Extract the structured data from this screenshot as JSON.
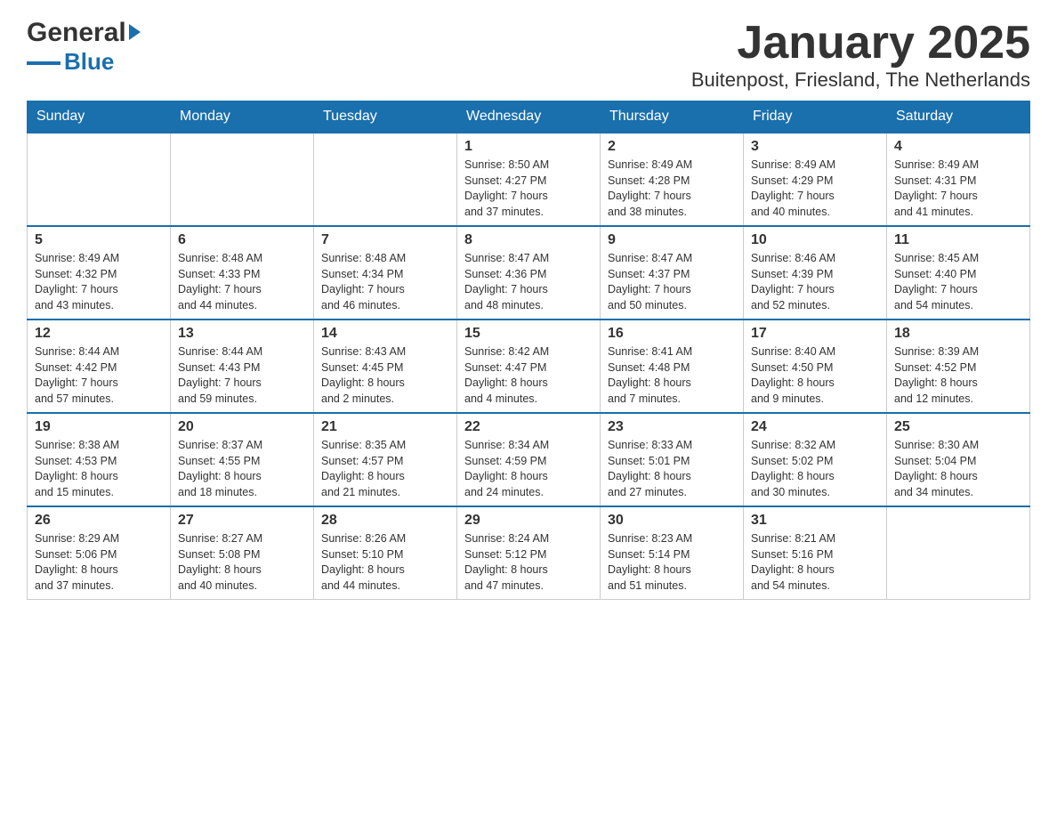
{
  "header": {
    "logo_general": "General",
    "logo_blue": "Blue",
    "title": "January 2025",
    "subtitle": "Buitenpost, Friesland, The Netherlands"
  },
  "calendar": {
    "days_of_week": [
      "Sunday",
      "Monday",
      "Tuesday",
      "Wednesday",
      "Thursday",
      "Friday",
      "Saturday"
    ],
    "weeks": [
      [
        {
          "day": "",
          "info": ""
        },
        {
          "day": "",
          "info": ""
        },
        {
          "day": "",
          "info": ""
        },
        {
          "day": "1",
          "info": "Sunrise: 8:50 AM\nSunset: 4:27 PM\nDaylight: 7 hours\nand 37 minutes."
        },
        {
          "day": "2",
          "info": "Sunrise: 8:49 AM\nSunset: 4:28 PM\nDaylight: 7 hours\nand 38 minutes."
        },
        {
          "day": "3",
          "info": "Sunrise: 8:49 AM\nSunset: 4:29 PM\nDaylight: 7 hours\nand 40 minutes."
        },
        {
          "day": "4",
          "info": "Sunrise: 8:49 AM\nSunset: 4:31 PM\nDaylight: 7 hours\nand 41 minutes."
        }
      ],
      [
        {
          "day": "5",
          "info": "Sunrise: 8:49 AM\nSunset: 4:32 PM\nDaylight: 7 hours\nand 43 minutes."
        },
        {
          "day": "6",
          "info": "Sunrise: 8:48 AM\nSunset: 4:33 PM\nDaylight: 7 hours\nand 44 minutes."
        },
        {
          "day": "7",
          "info": "Sunrise: 8:48 AM\nSunset: 4:34 PM\nDaylight: 7 hours\nand 46 minutes."
        },
        {
          "day": "8",
          "info": "Sunrise: 8:47 AM\nSunset: 4:36 PM\nDaylight: 7 hours\nand 48 minutes."
        },
        {
          "day": "9",
          "info": "Sunrise: 8:47 AM\nSunset: 4:37 PM\nDaylight: 7 hours\nand 50 minutes."
        },
        {
          "day": "10",
          "info": "Sunrise: 8:46 AM\nSunset: 4:39 PM\nDaylight: 7 hours\nand 52 minutes."
        },
        {
          "day": "11",
          "info": "Sunrise: 8:45 AM\nSunset: 4:40 PM\nDaylight: 7 hours\nand 54 minutes."
        }
      ],
      [
        {
          "day": "12",
          "info": "Sunrise: 8:44 AM\nSunset: 4:42 PM\nDaylight: 7 hours\nand 57 minutes."
        },
        {
          "day": "13",
          "info": "Sunrise: 8:44 AM\nSunset: 4:43 PM\nDaylight: 7 hours\nand 59 minutes."
        },
        {
          "day": "14",
          "info": "Sunrise: 8:43 AM\nSunset: 4:45 PM\nDaylight: 8 hours\nand 2 minutes."
        },
        {
          "day": "15",
          "info": "Sunrise: 8:42 AM\nSunset: 4:47 PM\nDaylight: 8 hours\nand 4 minutes."
        },
        {
          "day": "16",
          "info": "Sunrise: 8:41 AM\nSunset: 4:48 PM\nDaylight: 8 hours\nand 7 minutes."
        },
        {
          "day": "17",
          "info": "Sunrise: 8:40 AM\nSunset: 4:50 PM\nDaylight: 8 hours\nand 9 minutes."
        },
        {
          "day": "18",
          "info": "Sunrise: 8:39 AM\nSunset: 4:52 PM\nDaylight: 8 hours\nand 12 minutes."
        }
      ],
      [
        {
          "day": "19",
          "info": "Sunrise: 8:38 AM\nSunset: 4:53 PM\nDaylight: 8 hours\nand 15 minutes."
        },
        {
          "day": "20",
          "info": "Sunrise: 8:37 AM\nSunset: 4:55 PM\nDaylight: 8 hours\nand 18 minutes."
        },
        {
          "day": "21",
          "info": "Sunrise: 8:35 AM\nSunset: 4:57 PM\nDaylight: 8 hours\nand 21 minutes."
        },
        {
          "day": "22",
          "info": "Sunrise: 8:34 AM\nSunset: 4:59 PM\nDaylight: 8 hours\nand 24 minutes."
        },
        {
          "day": "23",
          "info": "Sunrise: 8:33 AM\nSunset: 5:01 PM\nDaylight: 8 hours\nand 27 minutes."
        },
        {
          "day": "24",
          "info": "Sunrise: 8:32 AM\nSunset: 5:02 PM\nDaylight: 8 hours\nand 30 minutes."
        },
        {
          "day": "25",
          "info": "Sunrise: 8:30 AM\nSunset: 5:04 PM\nDaylight: 8 hours\nand 34 minutes."
        }
      ],
      [
        {
          "day": "26",
          "info": "Sunrise: 8:29 AM\nSunset: 5:06 PM\nDaylight: 8 hours\nand 37 minutes."
        },
        {
          "day": "27",
          "info": "Sunrise: 8:27 AM\nSunset: 5:08 PM\nDaylight: 8 hours\nand 40 minutes."
        },
        {
          "day": "28",
          "info": "Sunrise: 8:26 AM\nSunset: 5:10 PM\nDaylight: 8 hours\nand 44 minutes."
        },
        {
          "day": "29",
          "info": "Sunrise: 8:24 AM\nSunset: 5:12 PM\nDaylight: 8 hours\nand 47 minutes."
        },
        {
          "day": "30",
          "info": "Sunrise: 8:23 AM\nSunset: 5:14 PM\nDaylight: 8 hours\nand 51 minutes."
        },
        {
          "day": "31",
          "info": "Sunrise: 8:21 AM\nSunset: 5:16 PM\nDaylight: 8 hours\nand 54 minutes."
        },
        {
          "day": "",
          "info": ""
        }
      ]
    ]
  }
}
